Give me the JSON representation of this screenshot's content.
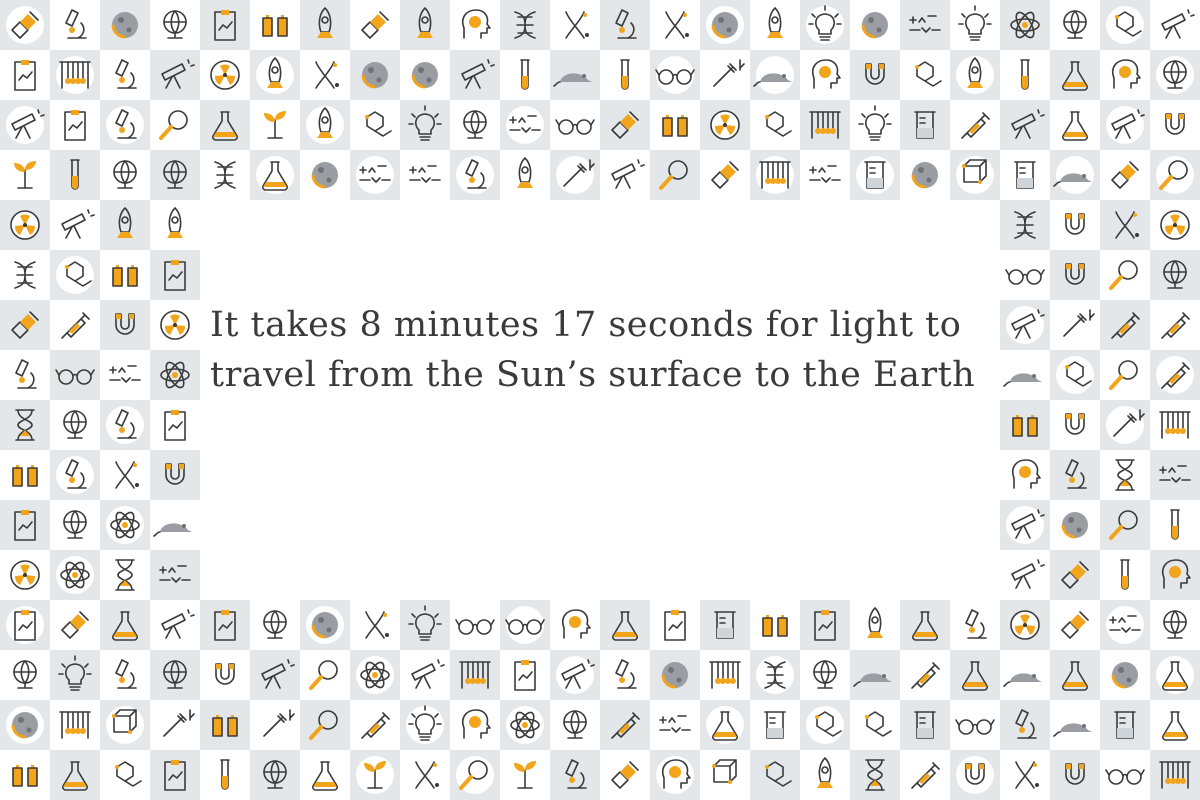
{
  "fact": {
    "line1": "It takes 8 minutes 17 seconds for light to",
    "line2": "travel from the Sun’s surface to the Earth"
  },
  "colors": {
    "tile_gray": "#e4e7ea",
    "tile_white": "#ffffff",
    "accent": "#f2a51a",
    "ink": "#3a3a3a"
  },
  "icons": [
    "flask-icon",
    "radiation-icon",
    "globe-icon",
    "microscope-icon",
    "bulb-icon",
    "dna-icon",
    "molecule-icon",
    "test-tube-icon",
    "gloves-icon",
    "magnet-icon",
    "atom-icon",
    "syringe-icon",
    "moon-icon",
    "telescope-icon",
    "satellite-icon",
    "formula-icon",
    "brain-head-icon",
    "clipboard-icon",
    "beaker-icon",
    "rocket-icon",
    "plant-icon",
    "mouse-icon",
    "cradle-icon",
    "hourglass-icon",
    "glasses-icon",
    "magnifier-icon",
    "pipette-icon",
    "chromosome-icon",
    "cube-icon"
  ]
}
